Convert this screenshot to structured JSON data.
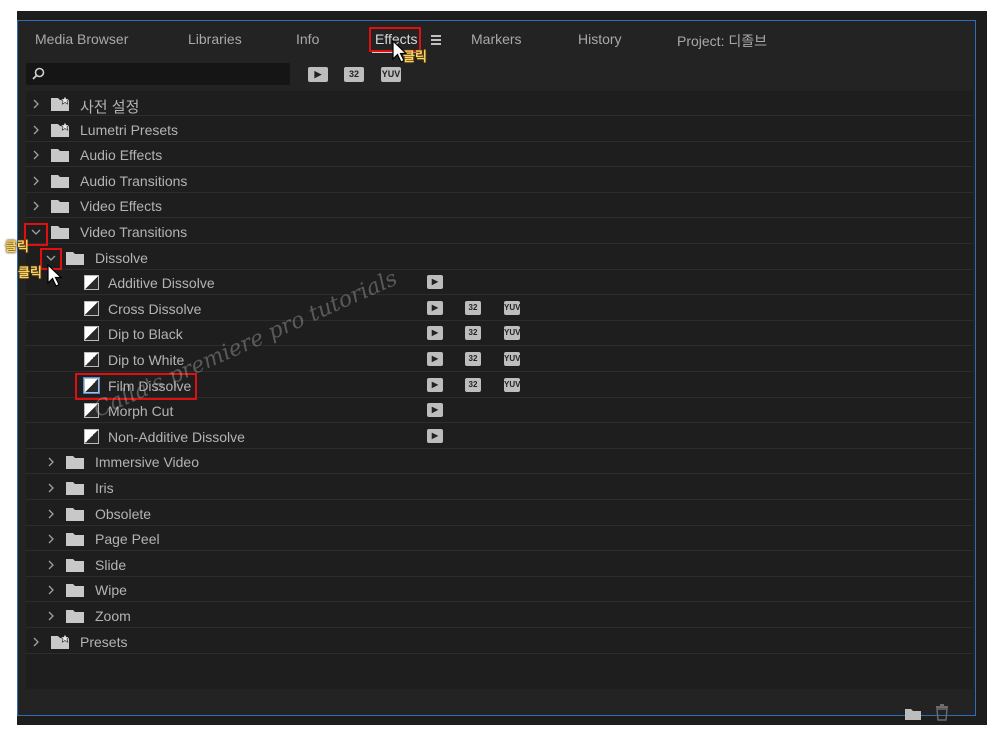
{
  "tabs": [
    {
      "label": "Media Browser"
    },
    {
      "label": "Libraries"
    },
    {
      "label": "Info"
    },
    {
      "label": "Effects"
    },
    {
      "label": "Markers"
    },
    {
      "label": "History"
    },
    {
      "label": "Project: 디졸브"
    }
  ],
  "toolbar": {
    "search_value": "",
    "filter_accelerated": "▶",
    "filter_32bit": "32",
    "filter_yuv": "YUV"
  },
  "tree": [
    {
      "label": "사전 설정",
      "icon": "preset-bin-icon"
    },
    {
      "label": "Lumetri Presets",
      "icon": "preset-bin-icon"
    },
    {
      "label": "Audio Effects",
      "icon": "folder-icon"
    },
    {
      "label": "Audio Transitions",
      "icon": "folder-icon"
    },
    {
      "label": "Video Effects",
      "icon": "folder-icon"
    },
    {
      "label": "Video Transitions",
      "icon": "folder-icon",
      "expanded": true
    },
    {
      "label": "Dissolve",
      "icon": "folder-icon",
      "expanded": true
    },
    {
      "label": "Additive Dissolve",
      "icon": "transition-icon",
      "badges": [
        "accelerated"
      ]
    },
    {
      "label": "Cross Dissolve",
      "icon": "transition-icon",
      "badges": [
        "accelerated",
        "32",
        "YUV"
      ]
    },
    {
      "label": "Dip to Black",
      "icon": "transition-icon",
      "badges": [
        "accelerated",
        "32",
        "YUV"
      ]
    },
    {
      "label": "Dip to White",
      "icon": "transition-icon",
      "badges": [
        "accelerated",
        "32",
        "YUV"
      ]
    },
    {
      "label": "Film Dissolve",
      "icon": "transition-icon",
      "badges": [
        "accelerated",
        "32",
        "YUV"
      ]
    },
    {
      "label": "Morph Cut",
      "icon": "transition-icon",
      "badges": [
        "accelerated"
      ]
    },
    {
      "label": "Non-Additive Dissolve",
      "icon": "transition-icon",
      "badges": [
        "accelerated"
      ]
    },
    {
      "label": "Immersive Video",
      "icon": "folder-icon"
    },
    {
      "label": "Iris",
      "icon": "folder-icon"
    },
    {
      "label": "Obsolete",
      "icon": "folder-icon"
    },
    {
      "label": "Page Peel",
      "icon": "folder-icon"
    },
    {
      "label": "Slide",
      "icon": "folder-icon"
    },
    {
      "label": "Wipe",
      "icon": "folder-icon"
    },
    {
      "label": "Zoom",
      "icon": "folder-icon"
    },
    {
      "label": "Presets",
      "icon": "preset-bin-icon"
    }
  ],
  "badge_text": {
    "accelerated": "▶",
    "b32": "32",
    "yuv": "YUV"
  },
  "annotations": {
    "click": "클릭"
  },
  "watermark": "Calla's premiere pro tutorials",
  "colors": {
    "accent_border": "#2d6db5",
    "highlight": "#e01010",
    "annotation": "#f6d36a"
  }
}
